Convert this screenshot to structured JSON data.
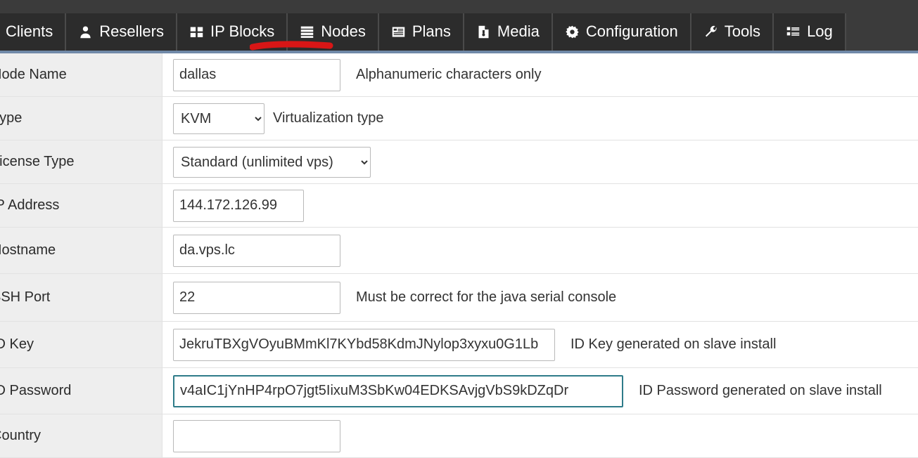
{
  "navbar": {
    "tabs": [
      {
        "label": "Clients",
        "icon": "none",
        "active": false
      },
      {
        "label": "Resellers",
        "icon": "user-icon",
        "active": false
      },
      {
        "label": "IP Blocks",
        "icon": "grid-icon",
        "active": false
      },
      {
        "label": "Nodes",
        "icon": "server-icon",
        "active": true
      },
      {
        "label": "Plans",
        "icon": "list-box-icon",
        "active": false
      },
      {
        "label": "Media",
        "icon": "document-icon",
        "active": false
      },
      {
        "label": "Configuration",
        "icon": "gear-icon",
        "active": false
      },
      {
        "label": "Tools",
        "icon": "wrench-icon",
        "active": false
      },
      {
        "label": "Log",
        "icon": "list-icon",
        "active": false
      }
    ],
    "annotation": {
      "target": "Nodes",
      "color": "#d81616"
    },
    "colors": {
      "bar": "#3b3b3b",
      "tab": "#2c2c2c",
      "accent_strip": "#7089a8"
    }
  },
  "form": {
    "rows": [
      {
        "label": "Node Name",
        "control": "text",
        "value": "dallas",
        "placeholder": "",
        "help": "Alphanumeric characters only",
        "focused": false
      },
      {
        "label": "Type",
        "control": "select",
        "value": "KVM",
        "options": [
          "KVM"
        ],
        "help": "Virtualization type",
        "focused": false
      },
      {
        "label": "License Type",
        "control": "select",
        "value": "Standard (unlimited vps)",
        "options": [
          "Standard (unlimited vps)"
        ],
        "help": "",
        "focused": false
      },
      {
        "label": "IP Address",
        "control": "text",
        "value": "144.172.126.99",
        "placeholder": "",
        "help": "",
        "focused": false
      },
      {
        "label": "Hostname",
        "control": "text",
        "value": "da.vps.lc",
        "placeholder": "",
        "help": "",
        "focused": false
      },
      {
        "label": "SSH Port",
        "control": "text",
        "value": "22",
        "placeholder": "",
        "help": "Must be correct for the java serial console",
        "focused": false
      },
      {
        "label": "ID Key",
        "control": "text",
        "value": "JekruTBXgVOyuBMmKl7KYbd58KdmJNylop3xyxu0G1Lb",
        "placeholder": "",
        "help": "ID Key generated on slave install",
        "focused": false
      },
      {
        "label": "ID Password",
        "control": "text",
        "value": "v4aIC1jYnHP4rpO7jgt5IixuM3SbKw04EDKSAvjgVbS9kDZqDr",
        "placeholder": "",
        "help": "ID Password generated on slave install",
        "focused": true
      },
      {
        "label": "Country",
        "control": "text",
        "value": "",
        "placeholder": "",
        "help": "",
        "focused": false
      }
    ],
    "colors": {
      "label_bg": "#eeeeee",
      "field_bg": "#ffffff",
      "border": "#e2e2e2",
      "input_border": "#b9b9b9",
      "focus_border": "#2e7b89"
    }
  }
}
